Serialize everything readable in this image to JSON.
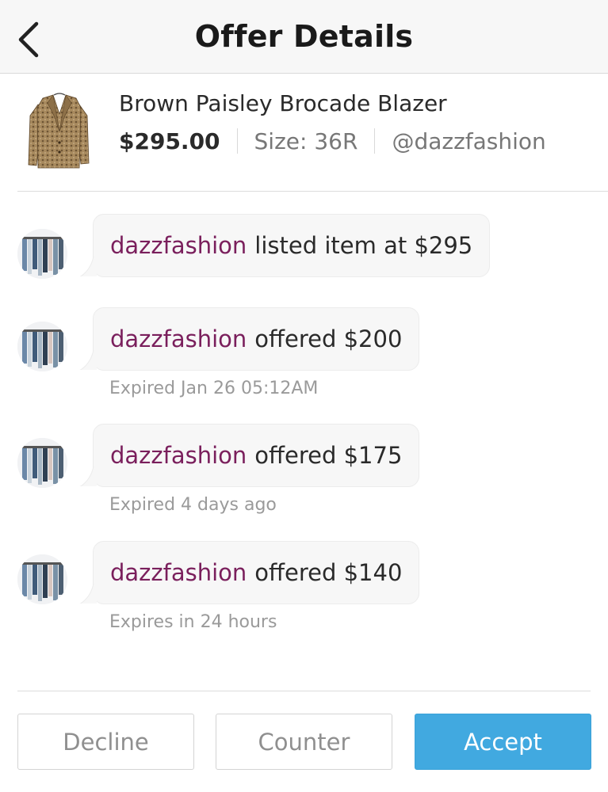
{
  "header": {
    "title": "Offer Details",
    "back_icon": "chevron-left-icon"
  },
  "item": {
    "title": "Brown Paisley Brocade Blazer",
    "price": "$295.00",
    "size": "Size: 36R",
    "seller": "@dazzfashion"
  },
  "feed": [
    {
      "user": "dazzfashion",
      "text": "listed item at $295",
      "sub": ""
    },
    {
      "user": "dazzfashion",
      "text": "offered $200",
      "sub": "Expired Jan 26 05:12AM"
    },
    {
      "user": "dazzfashion",
      "text": "offered $175",
      "sub": "Expired 4 days ago"
    },
    {
      "user": "dazzfashion",
      "text": "offered $140",
      "sub": "Expires in 24 hours"
    }
  ],
  "actions": {
    "decline": "Decline",
    "counter": "Counter",
    "accept": "Accept"
  },
  "colors": {
    "accent": "#41a9e0",
    "username": "#7a1f5c"
  }
}
